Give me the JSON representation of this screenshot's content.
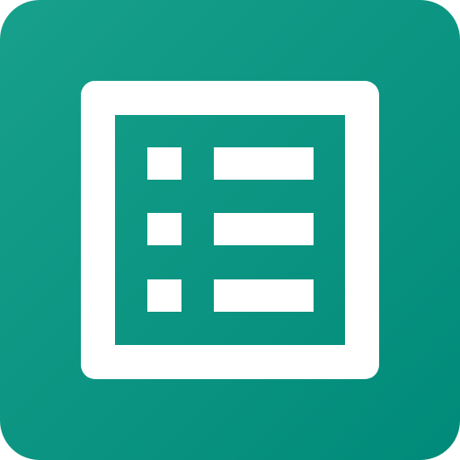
{
  "app": {
    "icon_name": "form-list-icon"
  },
  "colors": {
    "background_top_left": "#17a08b",
    "background_bottom_right": "#008a79",
    "glyph": "#ffffff"
  },
  "list": {
    "row_count": 3
  }
}
